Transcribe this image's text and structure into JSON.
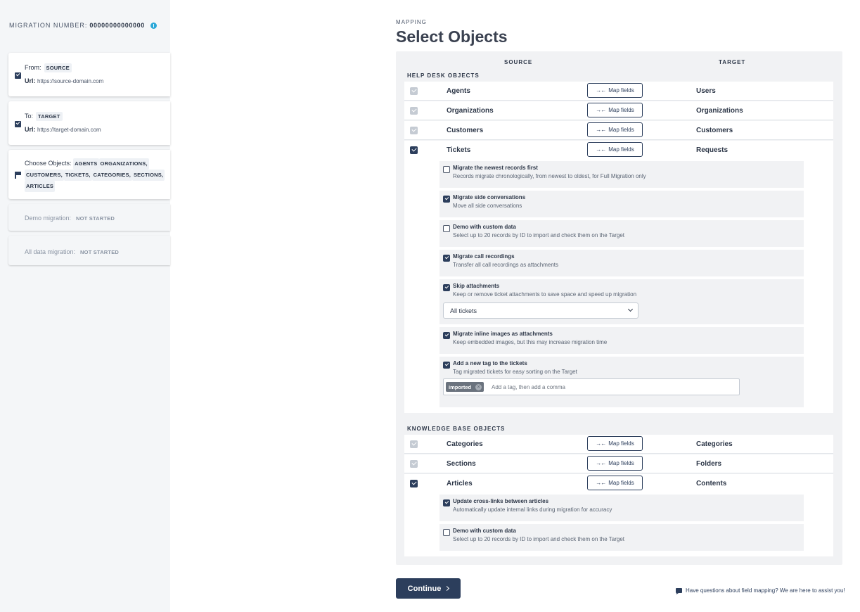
{
  "sidebar": {
    "migration_label": "MIGRATION NUMBER:",
    "migration_number": "00000000000000",
    "steps": {
      "from": {
        "label": "From:",
        "badge": "SOURCE",
        "url_label": "Url:",
        "url": "https://source-domain.com"
      },
      "to": {
        "label": "To:",
        "badge": "TARGET",
        "url_label": "Url:",
        "url": "https://target-domain.com"
      },
      "objects": {
        "label": "Choose Objects:",
        "items": [
          "AGENTS",
          "ORGANIZATIONS,",
          "CUSTOMERS,",
          "TICKETS,",
          "CATEGORIES,",
          "SECTIONS,",
          "ARTICLES"
        ]
      },
      "demo": {
        "label": "Demo migration:",
        "status": "NOT STARTED"
      },
      "full": {
        "label": "All data migration:",
        "status": "NOT STARTED"
      }
    }
  },
  "main": {
    "section_label": "MAPPING",
    "title": "Select Objects",
    "col_source": "SOURCE",
    "col_target": "TARGET",
    "map_label": "Map fields",
    "helpdesk_head": "HELP DESK OBJECTS",
    "kb_head": "KNOWLEDGE BASE OBJECTS",
    "helpdesk_rows": [
      {
        "source": "Agents",
        "target": "Users",
        "state": "locked"
      },
      {
        "source": "Organizations",
        "target": "Organizations",
        "state": "locked"
      },
      {
        "source": "Customers",
        "target": "Customers",
        "state": "locked"
      },
      {
        "source": "Tickets",
        "target": "Requests",
        "state": "checked"
      }
    ],
    "ticket_options": [
      {
        "title": "Migrate the newest records first",
        "desc": "Records migrate chronologically, from newest to oldest, for Full Migration only",
        "checked": false
      },
      {
        "title": "Migrate side conversations",
        "desc": "Move all side conversations",
        "checked": true
      },
      {
        "title": "Demo with custom data",
        "desc": "Select up to 20 records by ID to import and check them on the Target",
        "checked": false
      },
      {
        "title": "Migrate call recordings",
        "desc": "Transfer all call recordings as attachments",
        "checked": true
      },
      {
        "title": "Skip attachments",
        "desc": "Keep or remove ticket attachments to save space and speed up migration",
        "checked": true,
        "select_value": "All tickets"
      },
      {
        "title": "Migrate inline images as attachments",
        "desc": "Keep embedded images, but this may increase migration time",
        "checked": true
      },
      {
        "title": "Add a new tag to the tickets",
        "desc": "Tag migrated tickets for easy sorting on the Target",
        "checked": true,
        "tag": "imported",
        "tag_placeholder": "Add a tag, then add a comma"
      }
    ],
    "kb_rows": [
      {
        "source": "Categories",
        "target": "Categories",
        "state": "locked"
      },
      {
        "source": "Sections",
        "target": "Folders",
        "state": "locked"
      },
      {
        "source": "Articles",
        "target": "Contents",
        "state": "checked"
      }
    ],
    "article_options": [
      {
        "title": "Update cross-links between articles",
        "desc": "Automatically update internal links during migration for accuracy",
        "checked": true
      },
      {
        "title": "Demo with custom data",
        "desc": "Select up to 20 records by ID to import and check them on the Target",
        "checked": false
      }
    ],
    "continue_label": "Continue",
    "help_text": "Have questions about field mapping? We are here to assist you!"
  },
  "colors": {
    "primary": "#2c3e5c",
    "info": "#2aa8d8",
    "panel": "#f1f2f4",
    "sidebar": "#f4f6f8"
  }
}
